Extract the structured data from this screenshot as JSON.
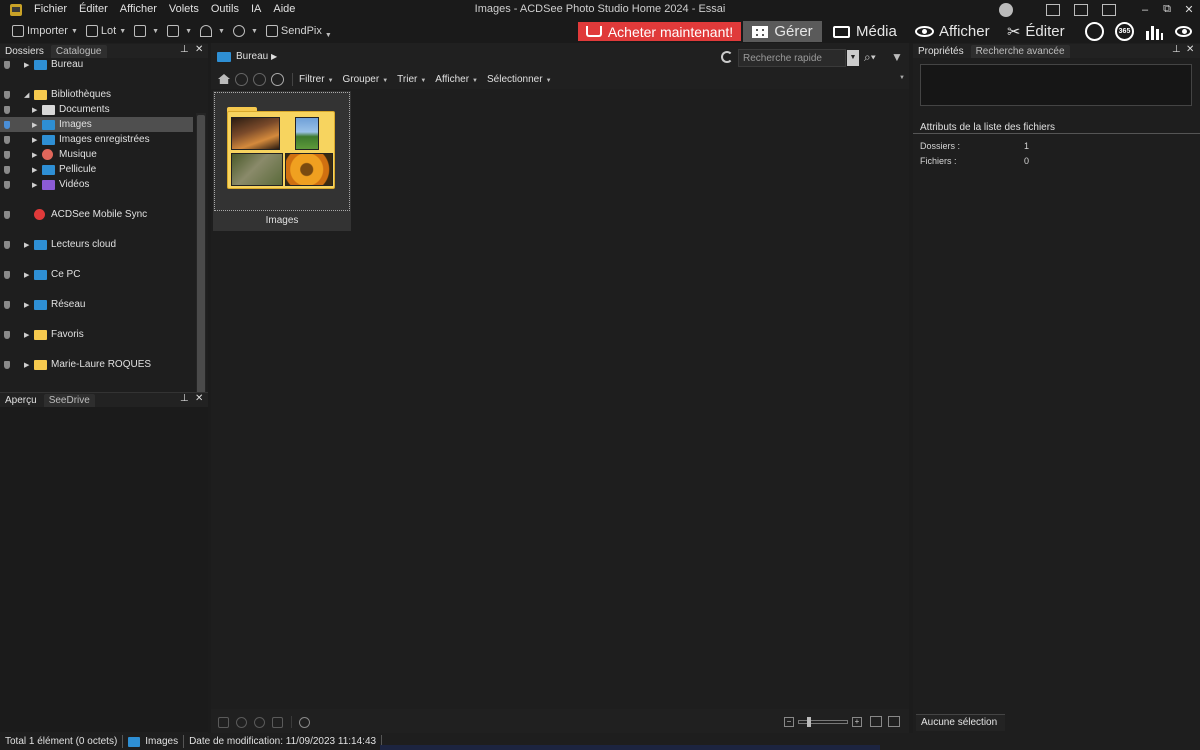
{
  "window": {
    "title": "Images - ACDSee Photo Studio Home 2024 - Essai",
    "menu": [
      "Fichier",
      "Éditer",
      "Afficher",
      "Volets",
      "Outils",
      "IA",
      "Aide"
    ],
    "controls": {
      "minimize": "–",
      "restore": "⧉",
      "close": "✕"
    }
  },
  "toolbar": {
    "importer": "Importer",
    "lot": "Lot",
    "sendpix": "SendPix",
    "buy_label": "Acheter maintenant!",
    "modes": {
      "gerer": "Gérer",
      "media": "Média",
      "afficher": "Afficher",
      "editer": "Éditer"
    },
    "badge_365": "365"
  },
  "left_panel": {
    "tabs": [
      "Dossiers",
      "Catalogue"
    ],
    "tree": [
      {
        "label": "Bureau",
        "icon": "desktop-icon",
        "icon_color": "#2e8fd4"
      },
      {
        "label": "Bibliothèques",
        "icon": "folder-icon",
        "icon_color": "#f6c94e"
      },
      {
        "label": "Documents",
        "icon": "document-icon",
        "icon_color": "#d8d8d8"
      },
      {
        "label": "Images",
        "icon": "image-icon",
        "icon_color": "#2e8fd4"
      },
      {
        "label": "Images enregistrées",
        "icon": "image-icon",
        "icon_color": "#2e8fd4"
      },
      {
        "label": "Musique",
        "icon": "music-icon",
        "icon_color": "#e0675b"
      },
      {
        "label": "Pellicule",
        "icon": "image-icon",
        "icon_color": "#2e8fd4"
      },
      {
        "label": "Vidéos",
        "icon": "video-icon",
        "icon_color": "#8c5bd6"
      },
      {
        "label": "ACDSee Mobile Sync",
        "icon": "sync-icon",
        "icon_color": "#e03a3a"
      },
      {
        "label": "Lecteurs cloud",
        "icon": "cloud-icon",
        "icon_color": "#2e8fd4"
      },
      {
        "label": "Ce PC",
        "icon": "computer-icon",
        "icon_color": "#2e8fd4"
      },
      {
        "label": "Réseau",
        "icon": "network-icon",
        "icon_color": "#2e8fd4"
      },
      {
        "label": "Favoris",
        "icon": "folder-icon",
        "icon_color": "#f6c94e"
      },
      {
        "label": "Marie-Laure ROQUES",
        "icon": "folder-icon",
        "icon_color": "#f6c94e"
      }
    ],
    "preview_tabs": [
      "Aperçu",
      "SeeDrive"
    ]
  },
  "center": {
    "path": "Bureau",
    "search_placeholder": "Recherche rapide",
    "nav_menus": [
      "Filtrer",
      "Grouper",
      "Trier",
      "Afficher",
      "Sélectionner"
    ],
    "items": [
      {
        "label": "Images",
        "type": "folder"
      }
    ]
  },
  "right_panel": {
    "tabs": [
      "Propriétés",
      "Recherche avancée"
    ],
    "section_title": "Attributs de la liste des fichiers",
    "attributes": [
      {
        "label": "Dossiers :",
        "value": "1"
      },
      {
        "label": "Fichiers :",
        "value": "0"
      }
    ],
    "bottom_tab": "Aucune sélection"
  },
  "status": {
    "total": "Total 1 élément  (0 octets)",
    "selected": "Images",
    "modified": "Date de modification: 11/09/2023 11:14:43"
  },
  "colors": {
    "accent_red": "#e03a3a",
    "active_mode": "#5a5a5a",
    "folder": "#f6c94e"
  }
}
